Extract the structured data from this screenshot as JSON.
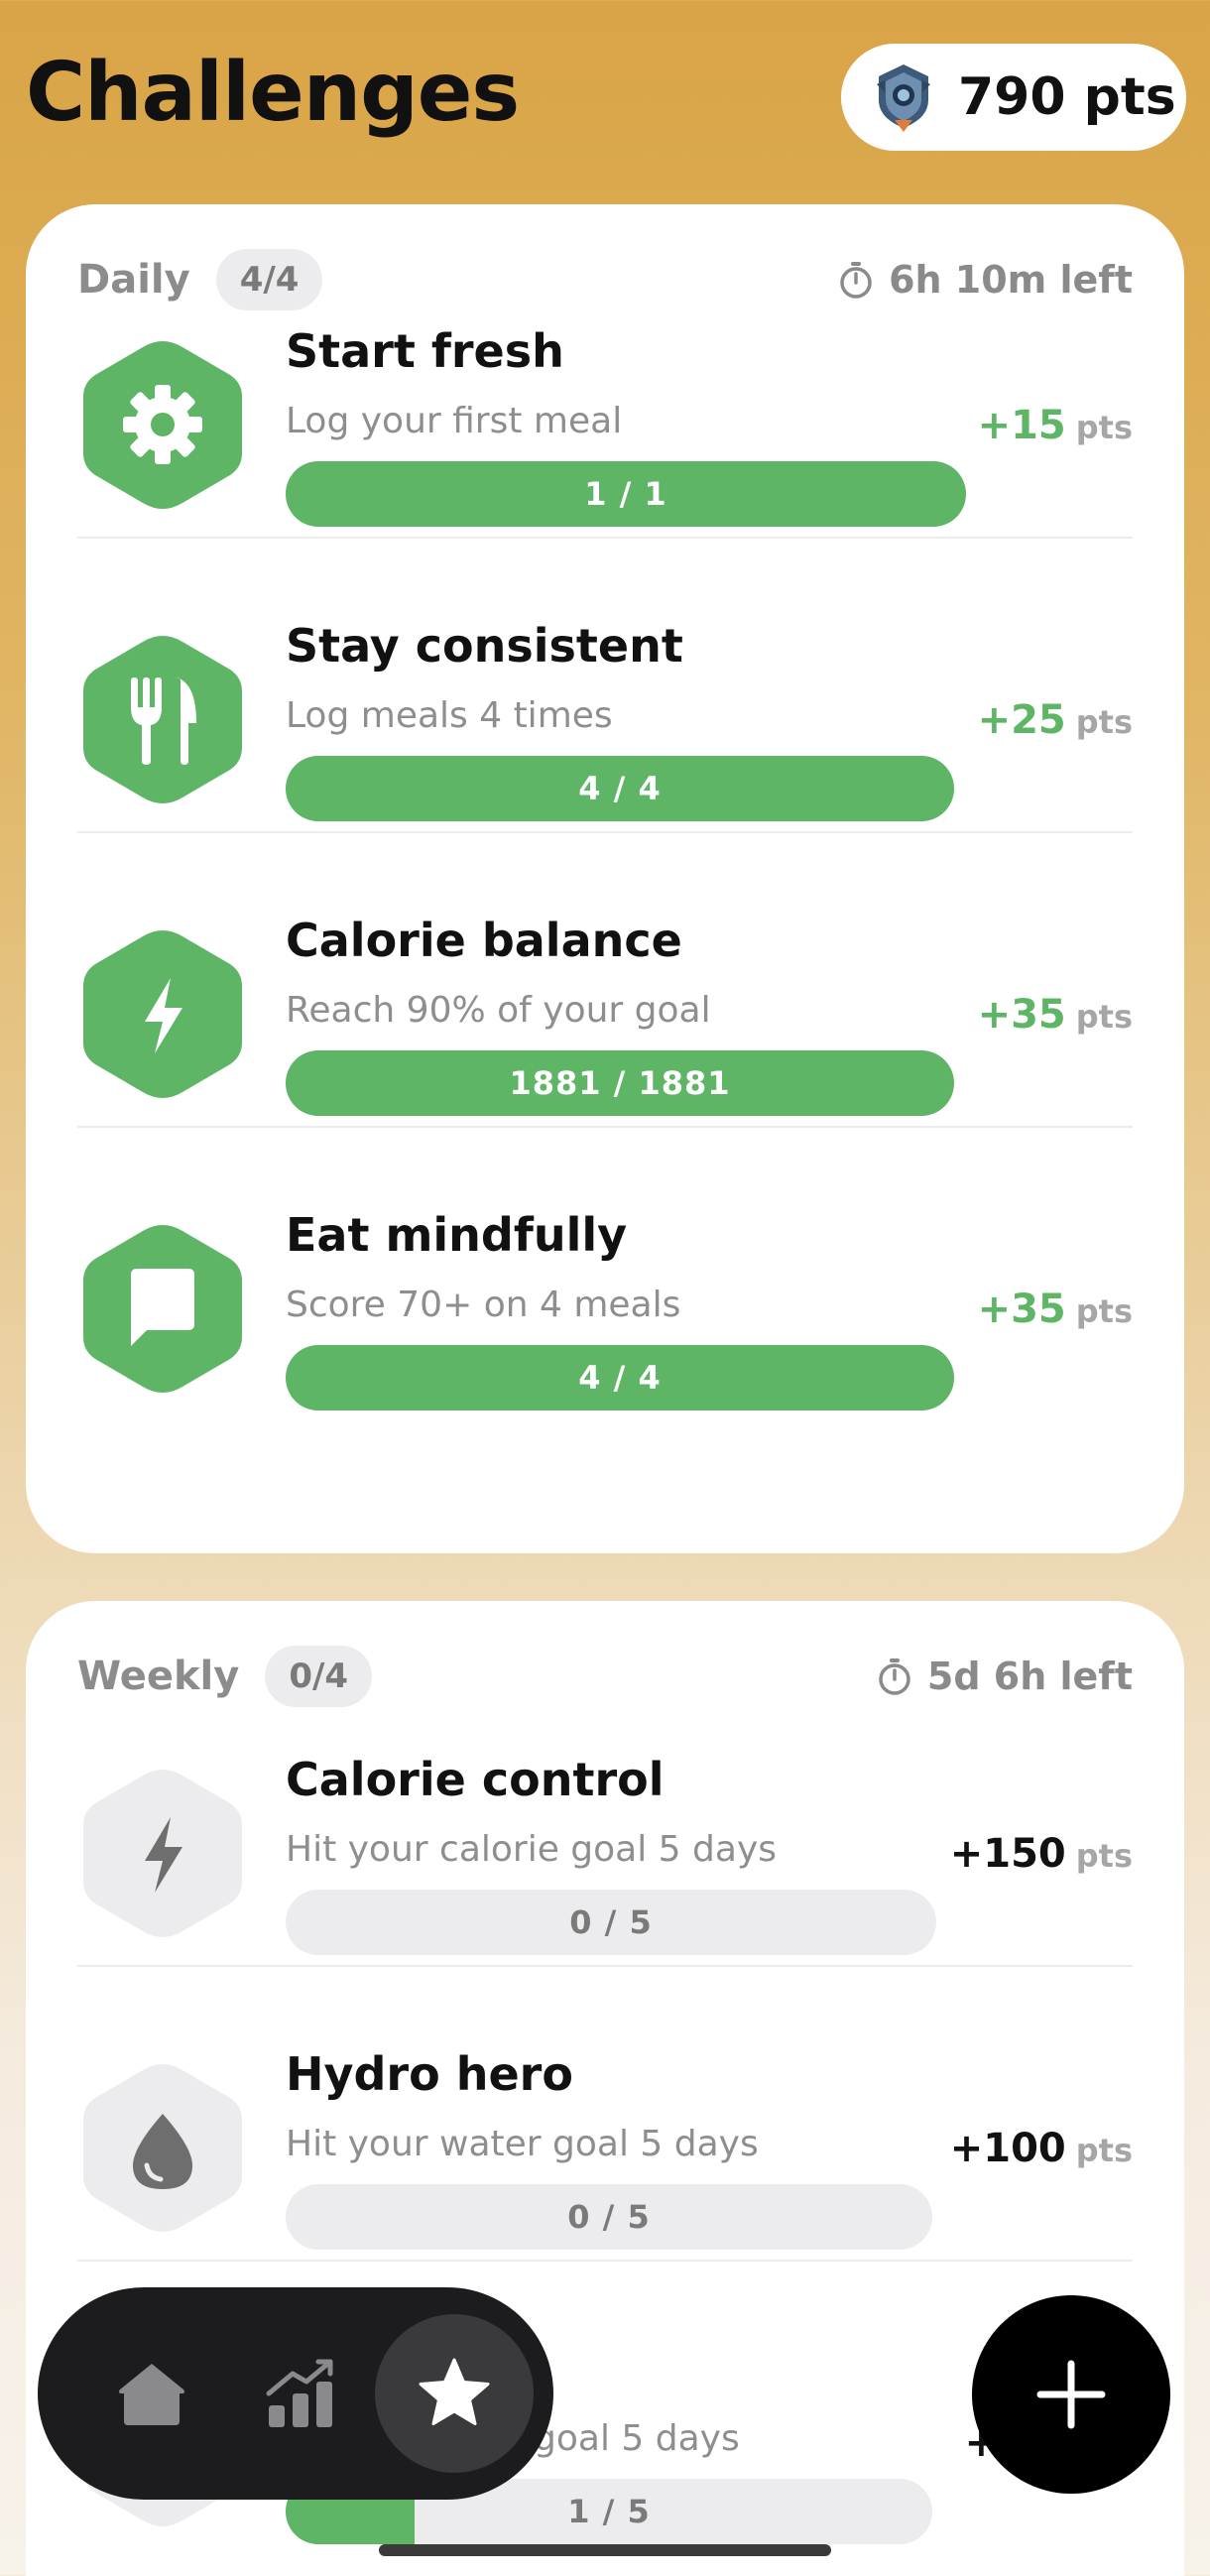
{
  "header": {
    "title": "Challenges",
    "points": "790 pts",
    "badge_icon": "rank-badge-icon"
  },
  "daily": {
    "name": "Daily",
    "count": "4/4",
    "timer": "6h 10m left",
    "items": [
      {
        "title": "Start fresh",
        "subtitle": "Log your first meal",
        "progress_label": "1 / 1",
        "progress": 1.0,
        "reward": "+15",
        "unit": "pts",
        "icon": "gear-icon",
        "completed": true
      },
      {
        "title": "Stay consistent",
        "subtitle": "Log meals 4 times",
        "progress_label": "4 / 4",
        "progress": 1.0,
        "reward": "+25",
        "unit": "pts",
        "icon": "utensils-icon",
        "completed": true
      },
      {
        "title": "Calorie balance",
        "subtitle": "Reach 90% of your goal",
        "progress_label": "1881 / 1881",
        "progress": 1.0,
        "reward": "+35",
        "unit": "pts",
        "icon": "lightning-icon",
        "completed": true
      },
      {
        "title": "Eat mindfully",
        "subtitle": "Score 70+ on 4 meals",
        "progress_label": "4 / 4",
        "progress": 1.0,
        "reward": "+35",
        "unit": "pts",
        "icon": "chat-bubble-icon",
        "completed": true
      }
    ]
  },
  "weekly": {
    "name": "Weekly",
    "count": "0/4",
    "timer": "5d 6h left",
    "items": [
      {
        "title": "Calorie control",
        "subtitle": "Hit your calorie goal 5 days",
        "progress_label": "0 / 5",
        "progress": 0.0,
        "reward": "+150",
        "unit": "pts",
        "icon": "lightning-icon",
        "completed": false
      },
      {
        "title": "Hydro hero",
        "subtitle": "Hit your water goal 5 days",
        "progress_label": "0 / 5",
        "progress": 0.0,
        "reward": "+100",
        "unit": "pts",
        "icon": "water-drop-icon",
        "completed": false
      },
      {
        "title": "",
        "subtitle": "goal 5 days",
        "progress_label": "1 / 5",
        "progress": 0.2,
        "reward": "+1",
        "unit": "",
        "icon": "hexagon-icon",
        "completed": false
      }
    ]
  },
  "nav": {
    "items": [
      "home-icon",
      "stats-icon",
      "star-icon"
    ],
    "active": "star-icon"
  },
  "fab_icon": "plus-icon",
  "colors": {
    "accent_green": "#5eb566",
    "inactive_gray": "#ececee",
    "background_top": "#d9a446",
    "nav_bg": "#1c1c1e"
  }
}
